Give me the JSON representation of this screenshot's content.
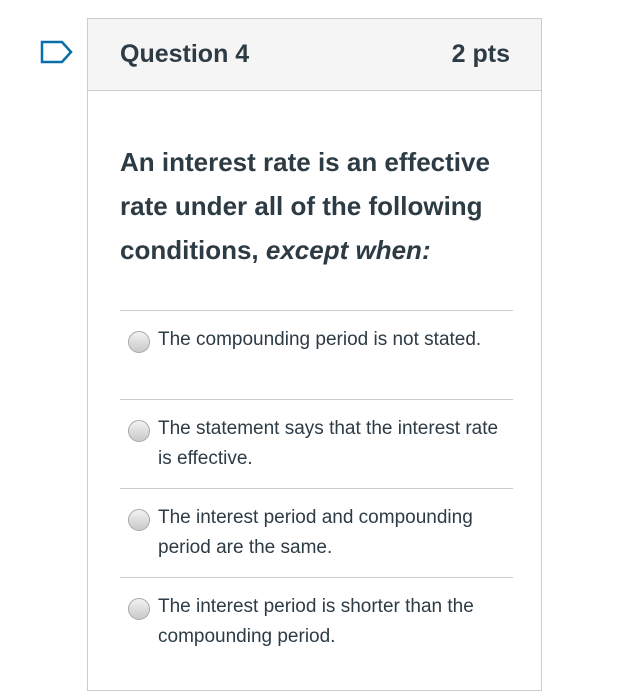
{
  "question": {
    "title": "Question 4",
    "points": "2 pts",
    "text_main": "An interest rate is an effective rate under all of the following conditions, ",
    "text_emphasis": "except when:"
  },
  "answers": [
    {
      "label": "The compounding period is not stated."
    },
    {
      "label": "The statement says that the interest rate is effective."
    },
    {
      "label": "The interest period and compounding period are the same."
    },
    {
      "label": "The interest period is shorter than the compounding period."
    }
  ],
  "colors": {
    "text": "#2d3b45",
    "border": "#c7cdd1",
    "header_bg": "#f5f5f5",
    "bookmark": "#0b6ea8"
  },
  "icons": {
    "bookmark": "bookmark-icon"
  }
}
